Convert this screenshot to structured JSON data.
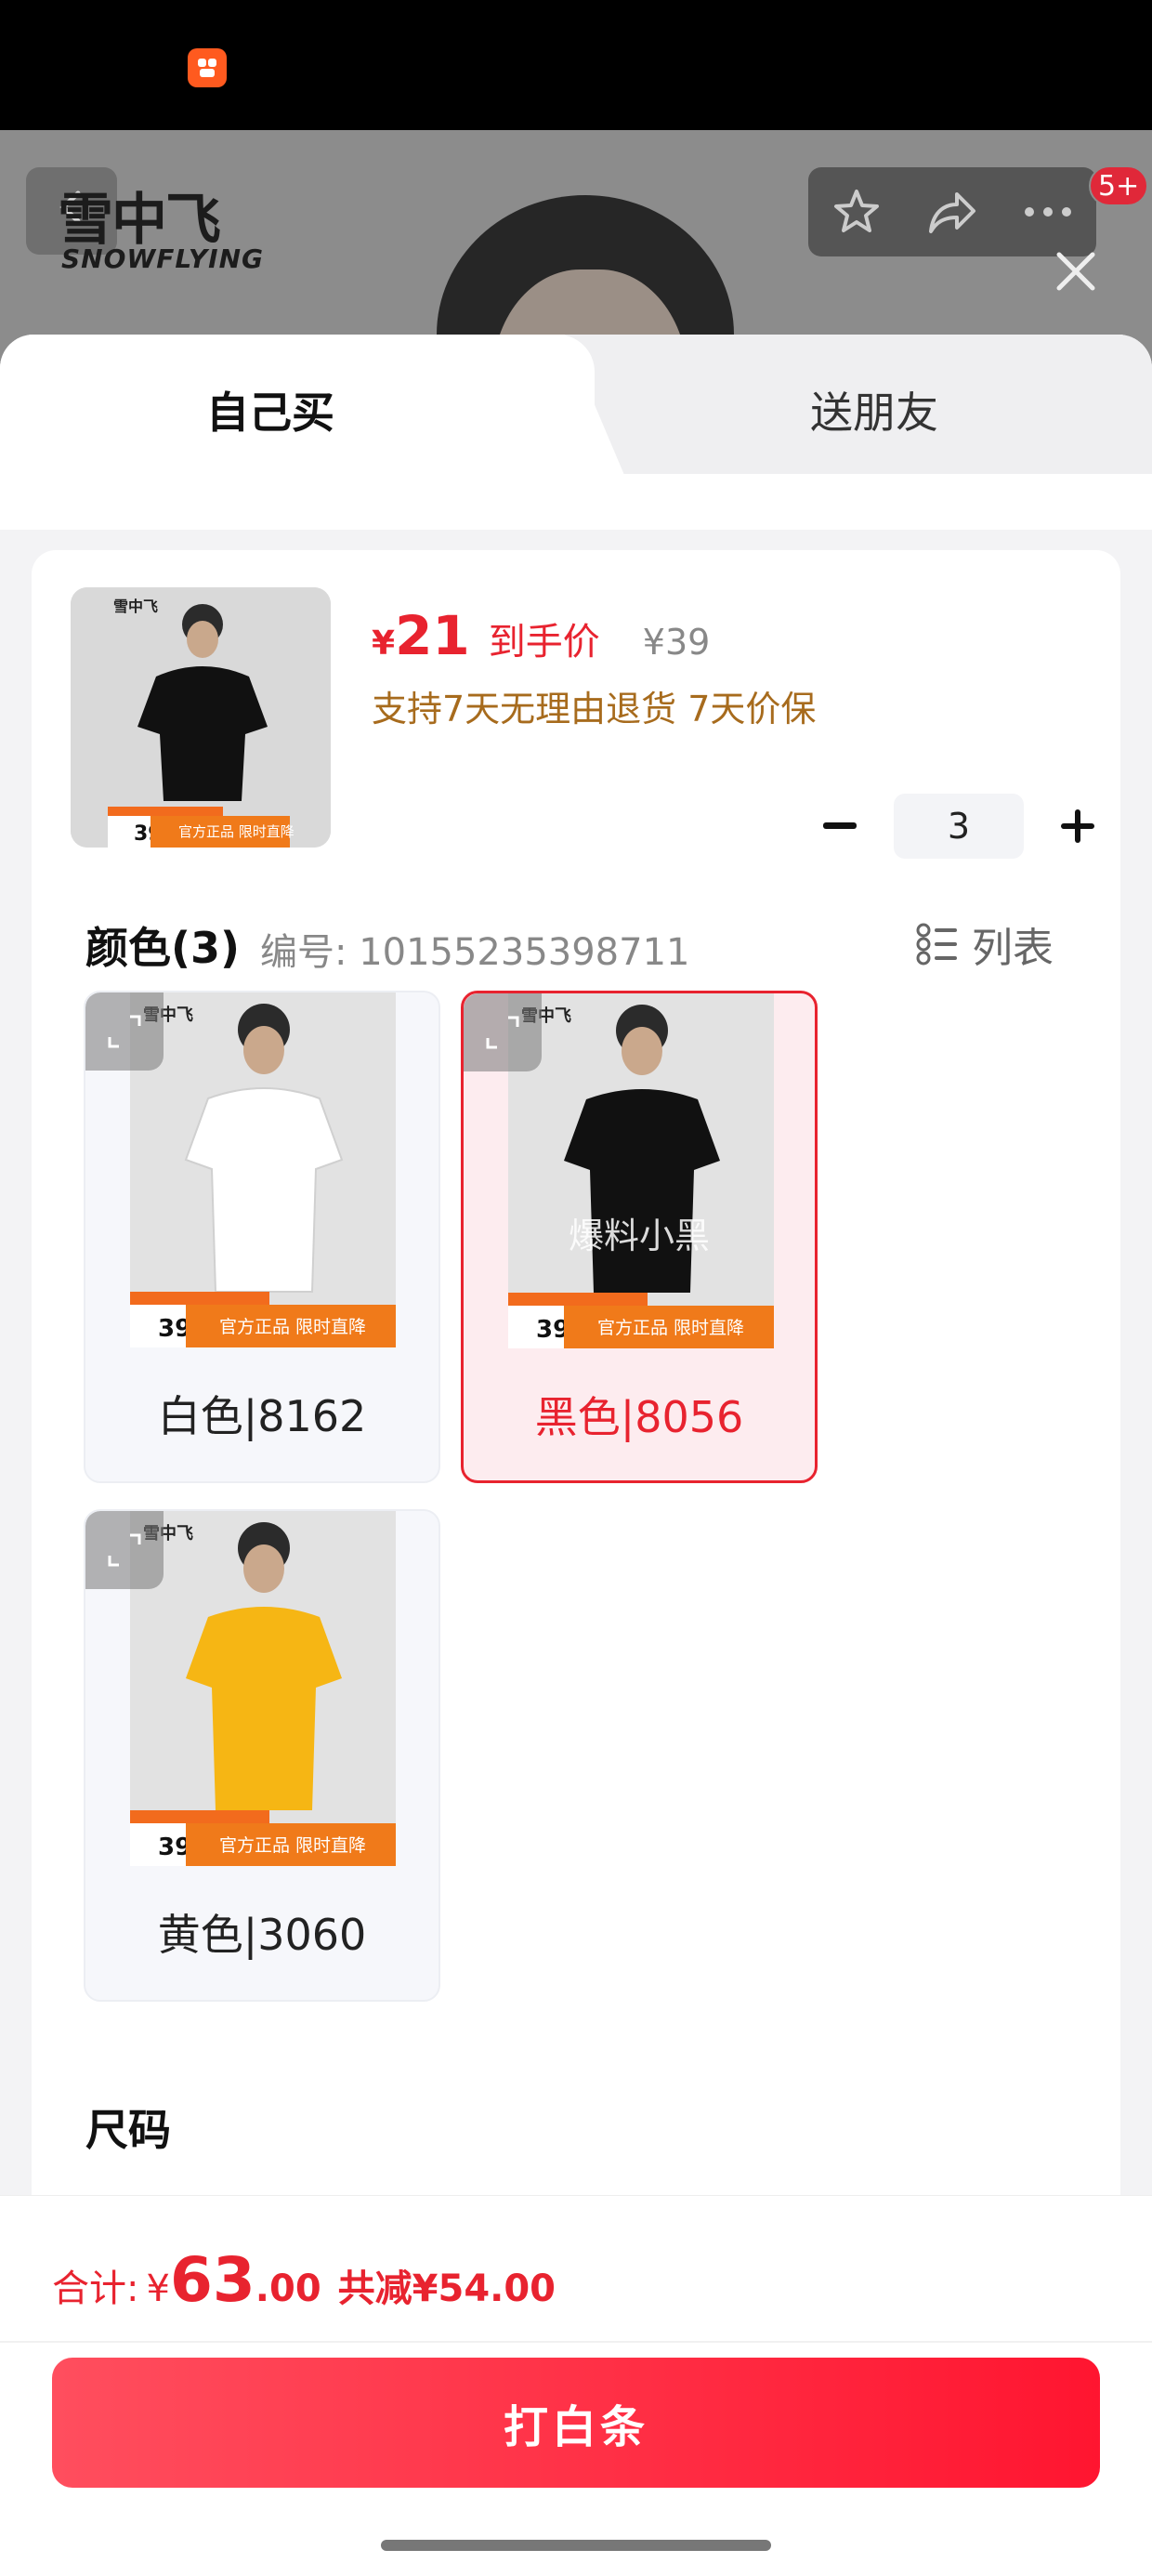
{
  "status_bar": {
    "app_icon": "kuaishou-app-icon"
  },
  "header": {
    "brand_logo_main": "雪中飞",
    "brand_logo_sub": "SNOWFLYING",
    "notification_badge": "5+",
    "icons": [
      "back-icon",
      "star-icon",
      "share-icon",
      "more-icon",
      "close-icon"
    ]
  },
  "tabs": {
    "self": "自己买",
    "gift": "送朋友"
  },
  "product": {
    "price_currency": "¥",
    "price": "21",
    "price_label": "到手价",
    "original_price": "¥39",
    "guarantee": "支持7天无理由退货  7天价保",
    "quantity": "3"
  },
  "color_section": {
    "title": "颜色(3)",
    "sku_number": "编号: 10155235398711",
    "list_toggle_label": "列表",
    "options": [
      {
        "label": "白色|8162",
        "shirt_color": "#ffffff",
        "selected": false
      },
      {
        "label": "黑色|8056",
        "shirt_color": "#111111",
        "selected": true,
        "overlay_text": "爆料小黑"
      },
      {
        "label": "黄色|3060",
        "shirt_color": "#f6b614",
        "selected": false
      }
    ]
  },
  "size_section": {
    "title": "尺码"
  },
  "footer": {
    "total_label": "合计:",
    "total_currency": "¥",
    "total_integer": "63",
    "total_decimal": ".00",
    "total_saved": "共减¥54.00",
    "buy_button": "打白条"
  },
  "theme": {
    "accent": "#e8232f",
    "guarantee_text": "#a76b1d"
  }
}
